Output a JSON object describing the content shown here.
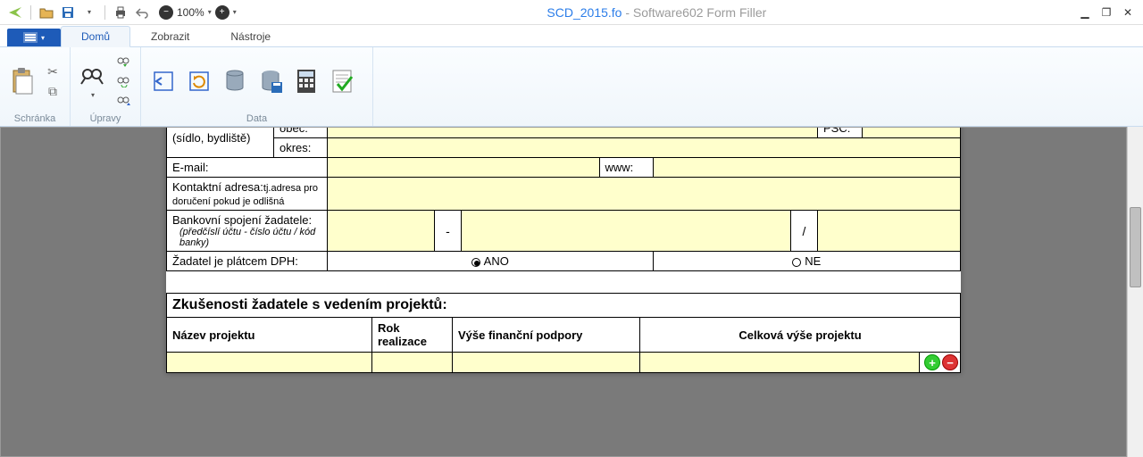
{
  "title": {
    "doc": "SCD_2015.fo",
    "sep": " - ",
    "app": "Software602 Form Filler"
  },
  "qat": {
    "zoom": "100%"
  },
  "tabs": {
    "file": "",
    "home": "Domů",
    "view": "Zobrazit",
    "tools": "Nástroje"
  },
  "ribbon": {
    "group_clipboard": "Schránka",
    "group_edits": "Úpravy",
    "group_data": "Data"
  },
  "form": {
    "residence_label": "(sídlo, bydliště)",
    "obec_label": "obec:",
    "psc_label": "PSČ:",
    "okres_label": "okres:",
    "email_label": "E-mail:",
    "www_label": "www:",
    "contact_label": "Kontaktní adresa:",
    "contact_note": "tj.adresa pro doručení pokud je odlišná",
    "bank_label": "Bankovní spojení žadatele:",
    "bank_hint": "(předčíslí účtu - číslo účtu / kód banky)",
    "bank_dash": "-",
    "bank_slash": "/",
    "vat_label": "Žadatel je plátcem DPH:",
    "vat_yes": "ANO",
    "vat_no": "NE"
  },
  "experience": {
    "title": "Zkušenosti žadatele s vedením projektů:",
    "col_name": "Název projektu",
    "col_year": "Rok realizace",
    "col_support": "Výše finanční podpory",
    "col_total": "Celková výše projektu"
  }
}
